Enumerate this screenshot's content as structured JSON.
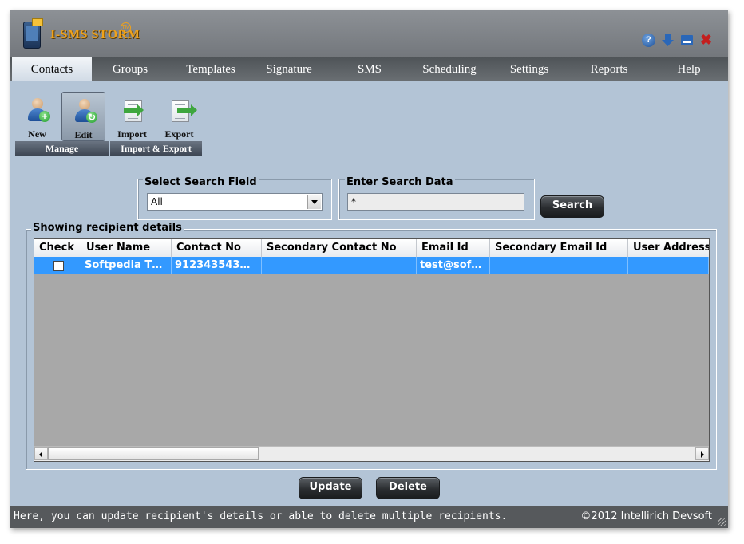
{
  "app": {
    "name": "I-SMS STORM",
    "trademark": "TM",
    "controls": {
      "help": "?"
    }
  },
  "menu": [
    {
      "label": "Contacts",
      "active": true
    },
    {
      "label": "Groups"
    },
    {
      "label": "Templates"
    },
    {
      "label": "Signature"
    },
    {
      "label": "SMS"
    },
    {
      "label": "Scheduling"
    },
    {
      "label": "Settings"
    },
    {
      "label": "Reports"
    },
    {
      "label": "Help"
    }
  ],
  "ribbon": {
    "buttons": [
      {
        "label": "New",
        "icon": "user-add-icon"
      },
      {
        "label": "Edit",
        "icon": "user-edit-icon",
        "selected": true
      },
      {
        "label": "Import",
        "icon": "import-icon"
      },
      {
        "label": "Export",
        "icon": "export-icon"
      }
    ],
    "groups": [
      "Manage",
      "Import & Export"
    ]
  },
  "search": {
    "field_legend": "Select Search Field",
    "field_value": "All",
    "data_legend": "Enter Search Data",
    "data_value": "*",
    "button": "Search"
  },
  "table": {
    "legend": "Showing recipient details",
    "columns": [
      "Check",
      "User Name",
      "Contact No",
      "Secondary Contact No",
      "Email Id",
      "Secondary Email Id",
      "User Address"
    ],
    "rows": [
      {
        "check": false,
        "user_name": "Softpedia T…",
        "contact_no": "912343543…",
        "secondary_contact_no": "",
        "email_id": "test@sof…",
        "secondary_email_id": "",
        "user_address": ""
      }
    ]
  },
  "actions": {
    "update": "Update",
    "delete": "Delete"
  },
  "status": {
    "text": "Here, you can update recipient's details or able to delete multiple recipients.",
    "copyright": "©2012 Intellirich Devsoft"
  },
  "colors": {
    "selection": "#3399ff",
    "logo": "#f0a21a",
    "close": "#c41e1e"
  }
}
